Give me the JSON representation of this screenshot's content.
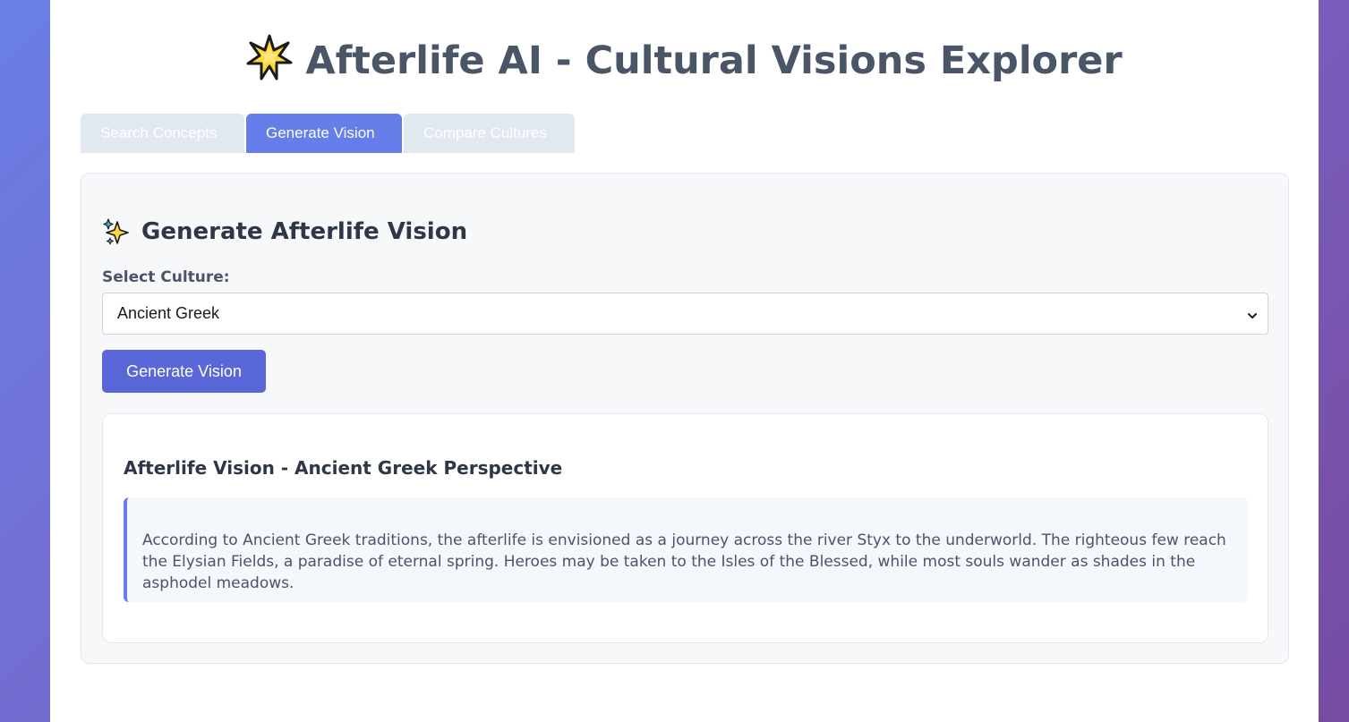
{
  "header": {
    "title": "Afterlife AI - Cultural Visions Explorer",
    "title_icon": "glowing-star-icon"
  },
  "tabs": [
    {
      "label": "Search Concepts",
      "active": false
    },
    {
      "label": "Generate Vision",
      "active": true
    },
    {
      "label": "Compare Cultures",
      "active": false
    }
  ],
  "generate": {
    "section_title": "Generate Afterlife Vision",
    "section_icon": "sparkles-icon",
    "culture_label": "Select Culture:",
    "culture_selected": "Ancient Greek",
    "button_label": "Generate Vision"
  },
  "result": {
    "title": "Afterlife Vision - Ancient Greek Perspective",
    "text": "According to Ancient Greek traditions, the afterlife is envisioned as a journey across the river Styx to the underworld. The righteous few reach the Elysian Fields, a paradise of eternal spring. Heroes may be taken to the Isles of the Blessed, while most souls wander as shades in the asphodel meadows."
  },
  "colors": {
    "accent": "#667eea",
    "button": "#5a67d8",
    "tab_inactive": "#e2e8f0",
    "title_text": "#4a5568"
  }
}
